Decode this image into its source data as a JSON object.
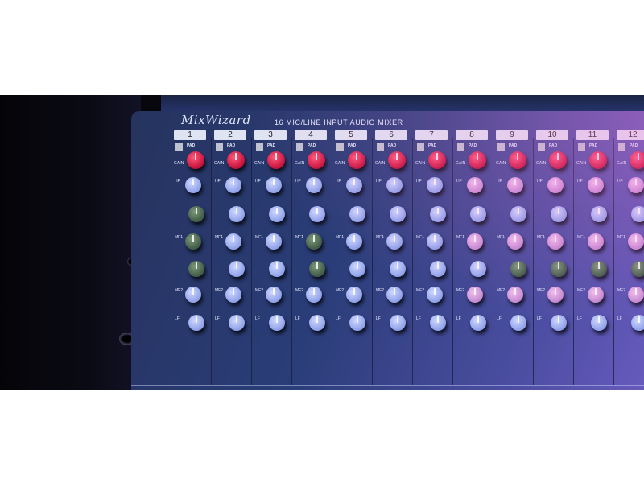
{
  "mixer": {
    "brand": "MixWizard",
    "model": "16 MIC/LINE INPUT AUDIO MIXER",
    "channels": [
      "1",
      "2",
      "3",
      "4",
      "5",
      "6",
      "7",
      "8",
      "9",
      "10",
      "11",
      "12"
    ],
    "pad_label": "PAD",
    "gain_label": "GAIN",
    "hf_label": "HF",
    "mf1_label": "MF1",
    "mf2_label": "MF2",
    "lf_label": "LF",
    "pre_label": "PRE"
  },
  "colors": {
    "panel": "#2a3d78",
    "gain_knob": "#c4103a",
    "eq_knob": "#8ea0e8",
    "eq_knob_dark": "#3f5a46"
  }
}
